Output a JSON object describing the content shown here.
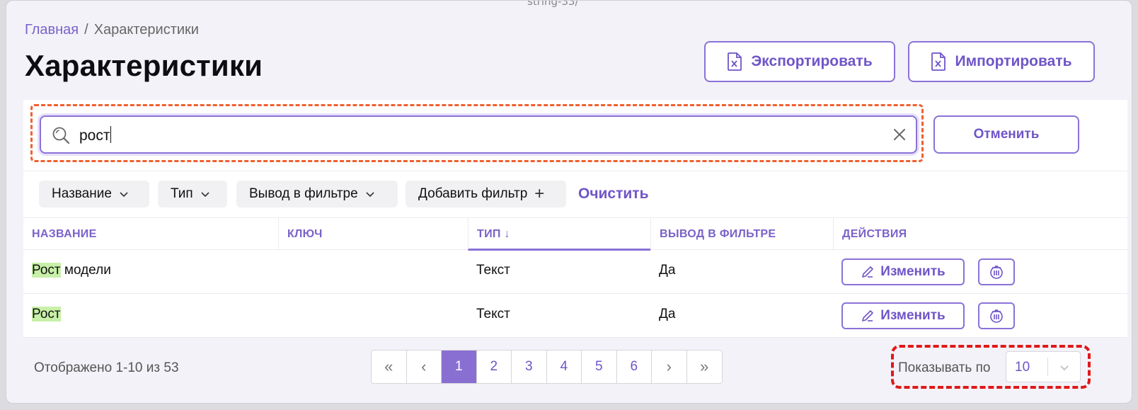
{
  "top_string": "string-33/",
  "breadcrumb": {
    "home": "Главная",
    "separator": "/",
    "current": "Характеристики"
  },
  "page_title": "Характеристики",
  "toolbar": {
    "export_label": "Экспортировать",
    "import_label": "Импортировать"
  },
  "search": {
    "value": "рост",
    "cancel_label": "Отменить"
  },
  "filters": {
    "name": "Название",
    "type": "Тип",
    "filter_output": "Вывод в фильтре",
    "add_filter": "Добавить фильтр",
    "add_icon": "+",
    "clear": "Очистить"
  },
  "table": {
    "columns": [
      "НАЗВАНИЕ",
      "КЛЮЧ",
      "ТИП ↓",
      "ВЫВОД В ФИЛЬТРЕ",
      "ДЕЙСТВИЯ"
    ],
    "rows": [
      {
        "name_highlight": "Рост",
        "name_rest": " модели",
        "key": "",
        "type": "Текст",
        "filter": "Да",
        "edit_label": "Изменить"
      },
      {
        "name_highlight": "Рост",
        "name_rest": "",
        "key": "",
        "type": "Текст",
        "filter": "Да",
        "edit_label": "Изменить"
      }
    ]
  },
  "footer": {
    "shown_text": "Отображено 1-10 из 53",
    "pages": {
      "first": "«",
      "prev": "‹",
      "items": [
        "1",
        "2",
        "3",
        "4",
        "5",
        "6"
      ],
      "next": "›",
      "last": "»",
      "active": "1"
    },
    "per_page_label": "Показывать по",
    "per_page_value": "10"
  },
  "colors": {
    "accent": "#8a72d8",
    "highlight": "#c8f0a8",
    "annotation_orange": "#f06030",
    "annotation_red": "#e01818"
  }
}
